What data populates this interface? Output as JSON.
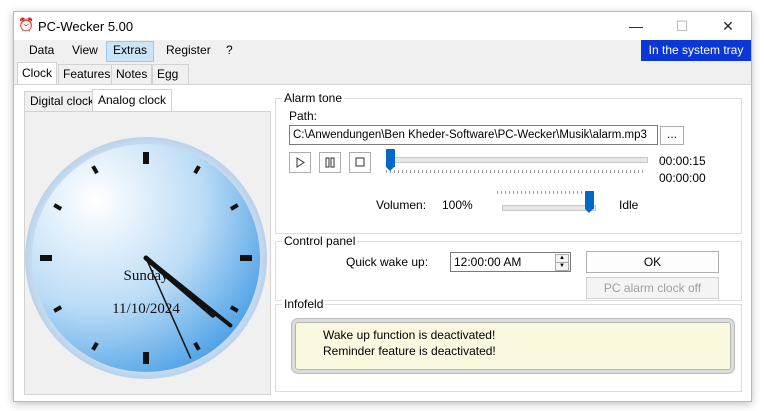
{
  "window": {
    "title": "PC-Wecker 5.00",
    "minimize_symbol": "—",
    "maximize_symbol": "☐",
    "close_symbol": "✕"
  },
  "menu": {
    "items": [
      "Data",
      "View",
      "Extras",
      "Register",
      "?"
    ],
    "active": "Extras",
    "tray_label": "In the system tray"
  },
  "tabs": [
    "Clock",
    "Features",
    "Notes",
    "Egg timer"
  ],
  "clock_tabs": [
    "Digital clock",
    "Analog clock"
  ],
  "analog_clock": {
    "day": "Sunday",
    "date": "11/10/2024",
    "time": {
      "hour": 4,
      "minute": 21,
      "second": 26
    }
  },
  "alarm_tone": {
    "group_label": "Alarm tone",
    "path_label": "Path:",
    "path": "C:\\Anwendungen\\Ben Kheder-Software\\PC-Wecker\\Musik\\alarm.mp3",
    "browse_label": "...",
    "elapsed": "00:00:15",
    "total": "00:00:00",
    "volume_label": "Volumen:",
    "volume_value": "100%",
    "status": "Idle",
    "playback_position": 0.0,
    "volume_level": 1.0
  },
  "control_panel": {
    "group_label": "Control panel",
    "quick_wake_label": "Quick wake up:",
    "quick_wake_value": "12:00:00 AM",
    "ok_label": "OK",
    "pc_alarm_off_label": "PC alarm clock off"
  },
  "infofeld": {
    "group_label": "Infofeld",
    "line1": "Wake up function is deactivated!",
    "line2": "Reminder feature is deactivated!"
  },
  "colors": {
    "tray_bg": "#0b37d6",
    "slider_thumb": "#0069c8",
    "info_bg": "#fbf8e0",
    "clock_face_light": "#ffffff",
    "clock_face_dark": "#5aa8e8"
  }
}
